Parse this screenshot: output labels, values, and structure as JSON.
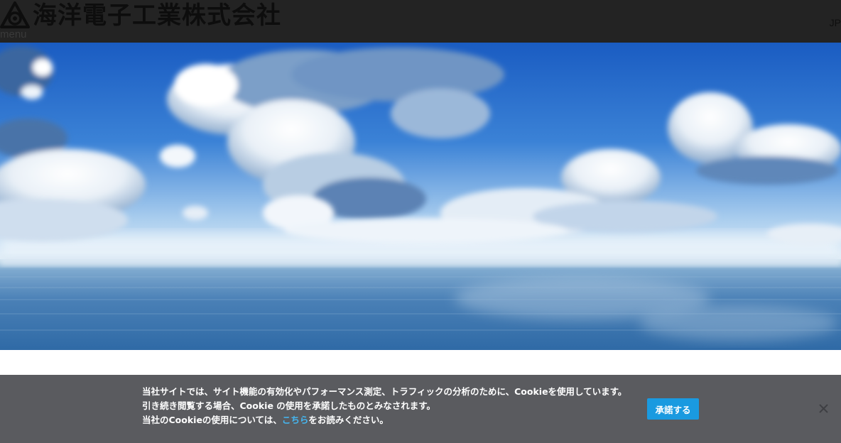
{
  "header": {
    "company_name": "海洋電子工業株式会社",
    "menu_label": "menu",
    "language": "JP"
  },
  "hero": {
    "image": "sky-and-ocean-horizon",
    "colors": {
      "sky_top": "#1f63c6",
      "sky_mid": "#3f86d8",
      "horizon": "#dcebf5",
      "sea": "#3f76ad"
    }
  },
  "cookie_notice": {
    "line1": "当社サイトでは、サイト機能の有効化やパフォーマンス測定、トラフィックの分析のために、Cookieを使用しています。",
    "line2": "引き続き閲覧する場合、Cookie の使用を承諾したものとみなされます。",
    "line3_prefix": "当社のCookieの使用については、",
    "link_text": "こちら",
    "line3_suffix": "をお読みください。",
    "accept_label": "承諾する",
    "close_icon": "close-icon",
    "colors": {
      "bar": "#5a5b5f",
      "button": "#1a9ae0",
      "link": "#45b6f0"
    }
  }
}
